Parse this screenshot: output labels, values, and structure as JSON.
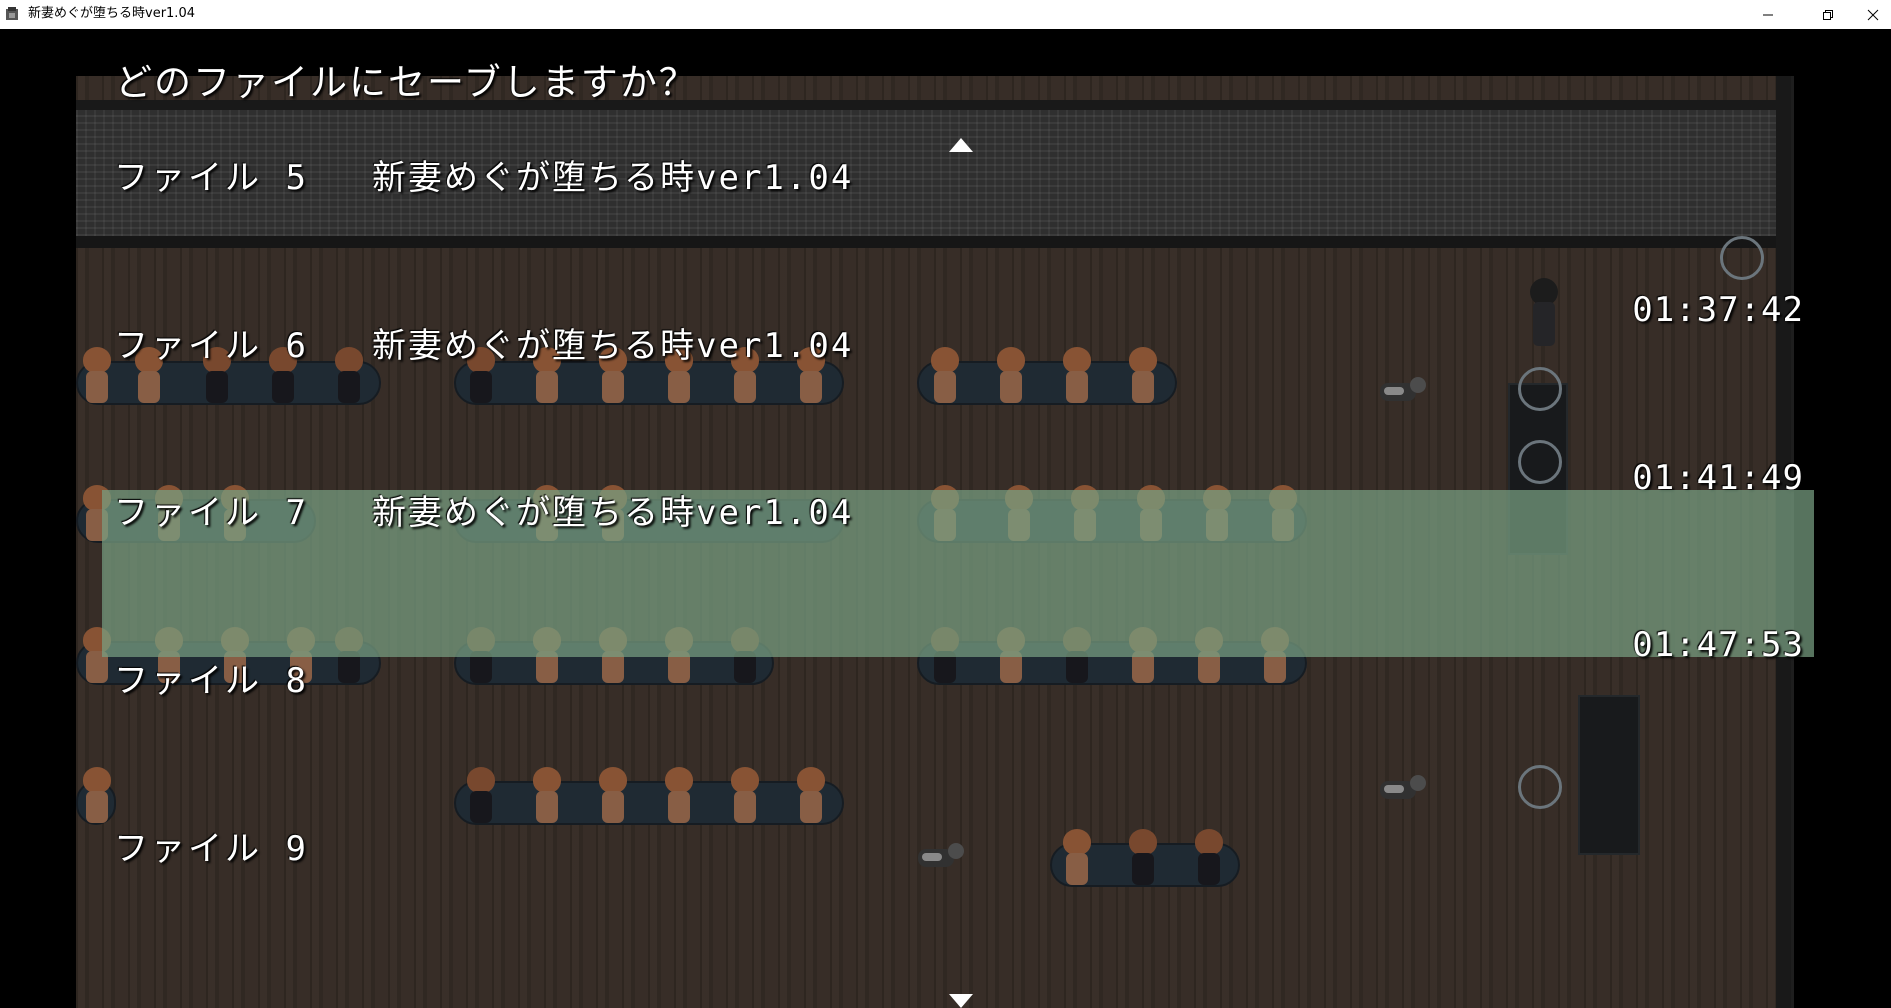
{
  "window": {
    "title": "新妻めぐが堕ちる時ver1.04",
    "controls": [
      "minimize",
      "maximize",
      "close"
    ]
  },
  "save_screen": {
    "prompt": "どのファイルにセーブしますか？",
    "slots": [
      {
        "label": "ファイル 5",
        "title": "新妻めぐが堕ちる時ver1.04",
        "time": "01:37:42",
        "selected": false
      },
      {
        "label": "ファイル 6",
        "title": "新妻めぐが堕ちる時ver1.04",
        "time": "01:41:49",
        "selected": false
      },
      {
        "label": "ファイル 7",
        "title": "新妻めぐが堕ちる時ver1.04",
        "time": "01:47:53",
        "selected": true
      },
      {
        "label": "ファイル 8",
        "title": "",
        "time": "",
        "selected": false
      },
      {
        "label": "ファイル 9",
        "title": "",
        "time": "",
        "selected": false
      }
    ],
    "scroll_up_icon": "triangle-up-icon",
    "scroll_down_icon": "triangle-down-icon"
  },
  "colors": {
    "selection_highlight": "#78a082",
    "text": "#ffffff",
    "floor": "#3d322a"
  }
}
